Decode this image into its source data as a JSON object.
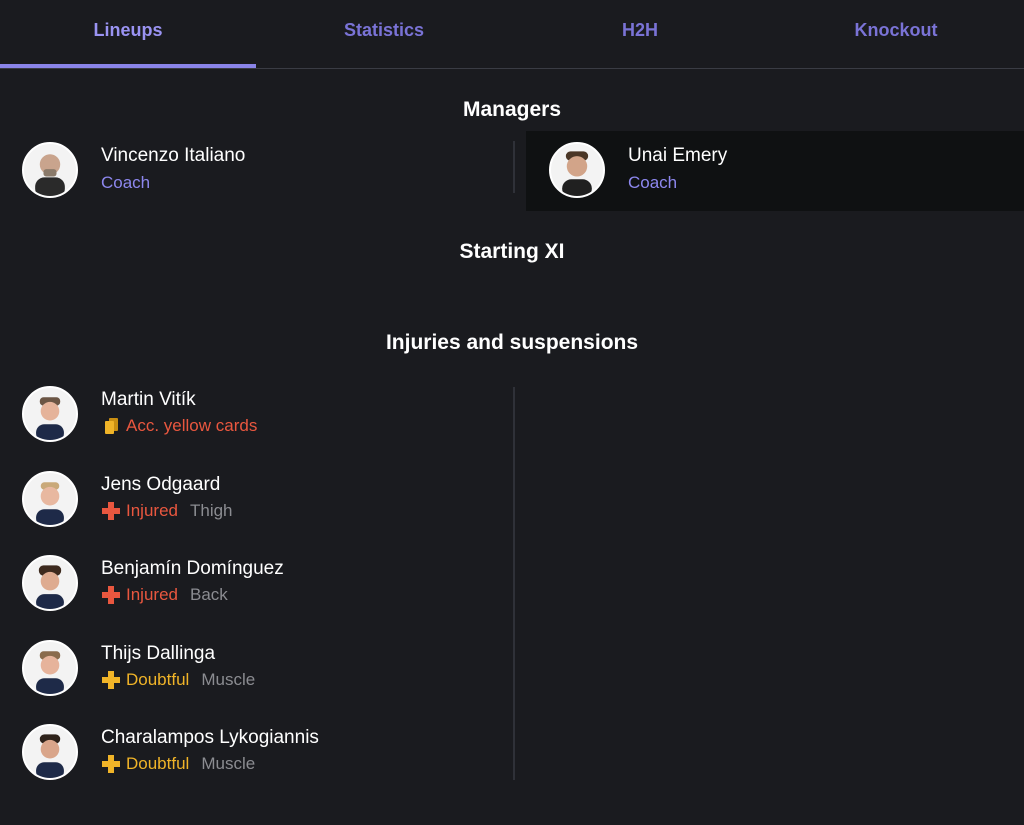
{
  "tabs": [
    "Lineups",
    "Statistics",
    "H2H",
    "Knockout"
  ],
  "sections": {
    "managers": "Managers",
    "starting": "Starting XI",
    "injuries": "Injuries and suspensions"
  },
  "managers": [
    {
      "name": "Vincenzo Italiano",
      "role": "Coach"
    },
    {
      "name": "Unai Emery",
      "role": "Coach"
    }
  ],
  "injuries": [
    {
      "name": "Martin Vitík",
      "status": "Acc. yellow cards",
      "detail": "",
      "icon": "yellow-cards-icon"
    },
    {
      "name": "Jens Odgaard",
      "status": "Injured",
      "detail": "Thigh",
      "icon": "injured-cross-icon"
    },
    {
      "name": "Benjamín Domínguez",
      "status": "Injured",
      "detail": "Back",
      "icon": "injured-cross-icon"
    },
    {
      "name": "Thijs Dallinga",
      "status": "Doubtful",
      "detail": "Muscle",
      "icon": "doubtful-cross-icon"
    },
    {
      "name": "Charalampos Lykogiannis",
      "status": "Doubtful",
      "detail": "Muscle",
      "icon": "doubtful-cross-icon"
    }
  ],
  "colors": {
    "accent": "#8d87ee",
    "injured": "#e9573f",
    "doubtful": "#f0b428",
    "background": "#1a1b1f"
  }
}
